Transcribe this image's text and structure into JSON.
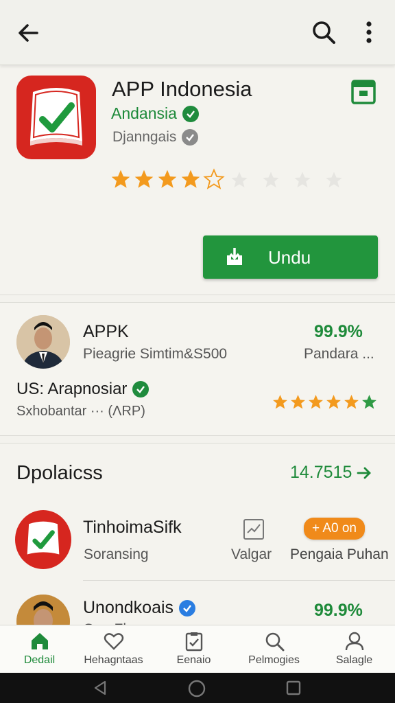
{
  "topbar": {
    "back_icon": "back-arrow-icon",
    "search_icon": "search-icon",
    "more_icon": "more-vert-icon"
  },
  "app": {
    "title": "APP Indonesia",
    "developer": "Andansia",
    "subtitle": "Djanngais",
    "rating_stars": 4,
    "install_label": "Undu",
    "colors": {
      "accent": "#22953d",
      "brand": "#d6261f",
      "star": "#f39a1e"
    }
  },
  "card2": {
    "title": "APPK",
    "subtitle": "Pieagrie Simtim&S500",
    "percent": "99.9%",
    "percent_sub": "Pandara ...",
    "line": "US: Arapnosiar",
    "footer": "Sxhobantar  ···  (ΛRP)",
    "rating_stars": 5
  },
  "card3": {
    "heading": "Dpolaicss",
    "link_value": "14.7515",
    "item1": {
      "title": "TinhoimaSifk",
      "subtitle": "Soransing",
      "check_label": "Valgar",
      "badge": "+ A0 on",
      "badge_sub": "Pengaia  Puhan"
    },
    "item2": {
      "title": "Unondkoais",
      "percent": "99.9%",
      "cut_text": "Gan Fk"
    }
  },
  "bottom_nav": {
    "items": [
      {
        "label": "Dedail",
        "icon": "home-icon",
        "active": true
      },
      {
        "label": "Hehagntaas",
        "icon": "heart-icon",
        "active": false
      },
      {
        "label": "Eenaio",
        "icon": "clipboard-check-icon",
        "active": false
      },
      {
        "label": "Pelmogies",
        "icon": "search-icon",
        "active": false
      },
      {
        "label": "Salagle",
        "icon": "profile-icon",
        "active": false
      }
    ]
  },
  "system_nav": {
    "back_icon": "system-back-icon",
    "home_icon": "system-home-icon",
    "recents_icon": "system-recents-icon"
  }
}
